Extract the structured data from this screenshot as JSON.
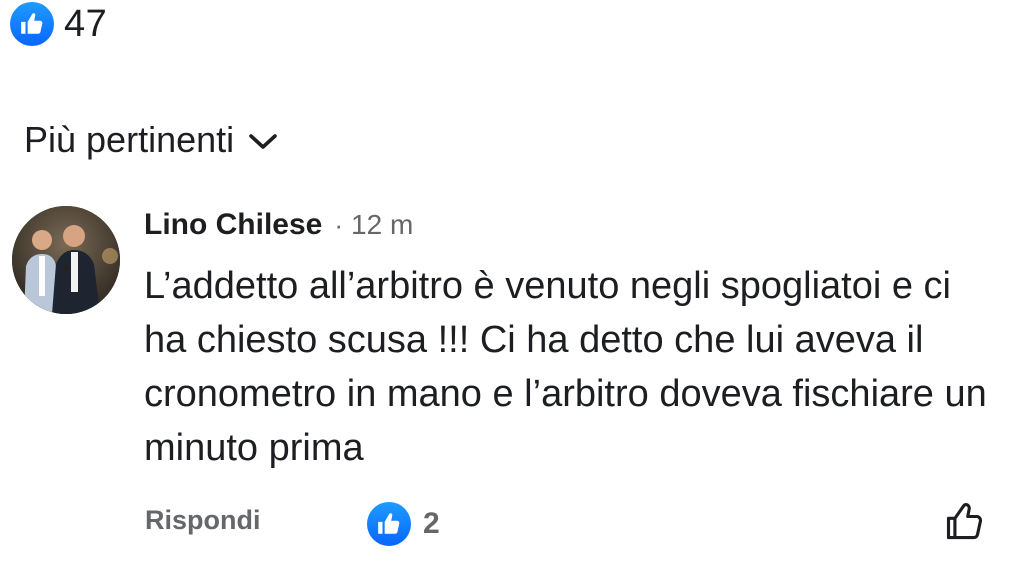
{
  "post": {
    "reaction_icon": "like-thumb-icon",
    "reaction_count": "47"
  },
  "sort": {
    "label": "Più pertinenti",
    "icon": "chevron-down-icon"
  },
  "comment": {
    "author": "Lino Chilese",
    "separator": "·",
    "timestamp": "12 m",
    "text": "L’addetto all’arbitro è venuto negli spogliatoi e ci ha chiesto scusa !!! Ci ha detto che lui aveva il cronometro in mano e l’arbitro doveva fischiare un minuto prima",
    "reply_label": "Rispondi",
    "reaction_icon": "like-thumb-icon",
    "reaction_count": "2",
    "like_icon": "thumb-up-outline-icon"
  },
  "colors": {
    "accent": "#0866ff",
    "text_primary": "#1c1e21",
    "text_secondary": "#65676b",
    "background": "#ffffff"
  }
}
